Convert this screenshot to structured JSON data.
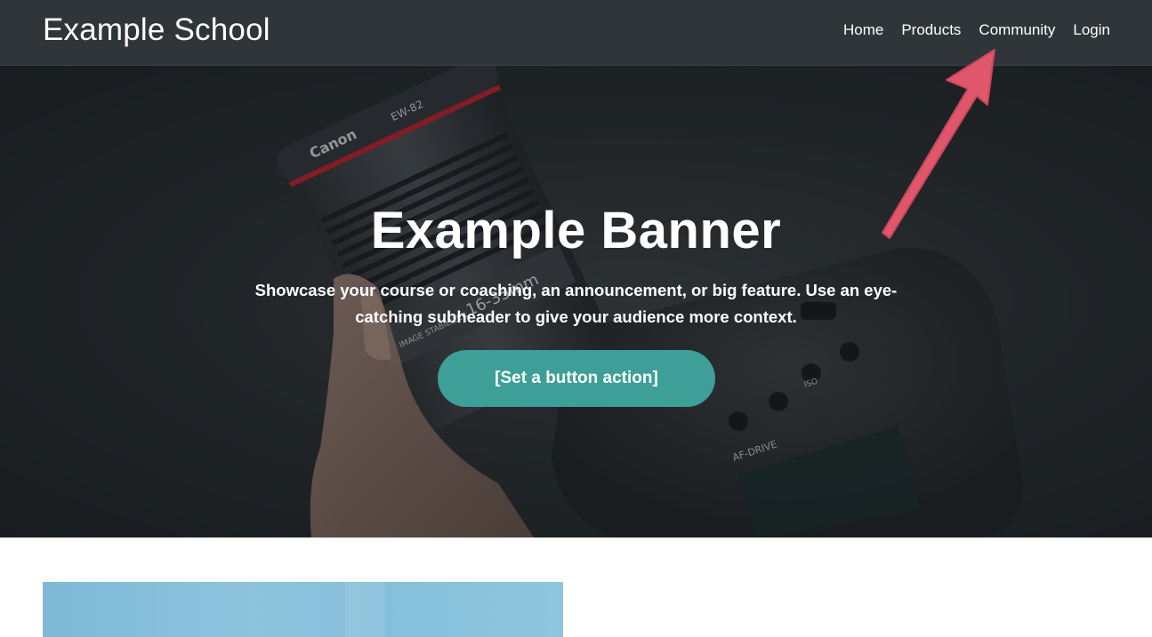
{
  "header": {
    "logo": "Example School",
    "nav": [
      {
        "label": "Home"
      },
      {
        "label": "Products"
      },
      {
        "label": "Community"
      },
      {
        "label": "Login"
      }
    ]
  },
  "hero": {
    "title": "Example Banner",
    "subtitle": "Showcase your course or coaching, an announcement, or big feature. Use an eye-catching subheader to give your audience more context.",
    "button_label": "[Set a button action]",
    "photo_lens_text": "Canon",
    "photo_hood_text": "EW-82",
    "photo_lens_spec": "16-35mm",
    "photo_lens_feature": "IMAGE STABILIZER",
    "photo_body_text": "AF-DRIVE",
    "photo_iso_text": "ISO"
  },
  "colors": {
    "header_bg": "#2f3538",
    "button_bg": "#3d9f97",
    "annotation_arrow": "#e0566a",
    "content_image": "#86bfda"
  },
  "icons": {
    "annotation": "arrow-pointer-icon"
  }
}
